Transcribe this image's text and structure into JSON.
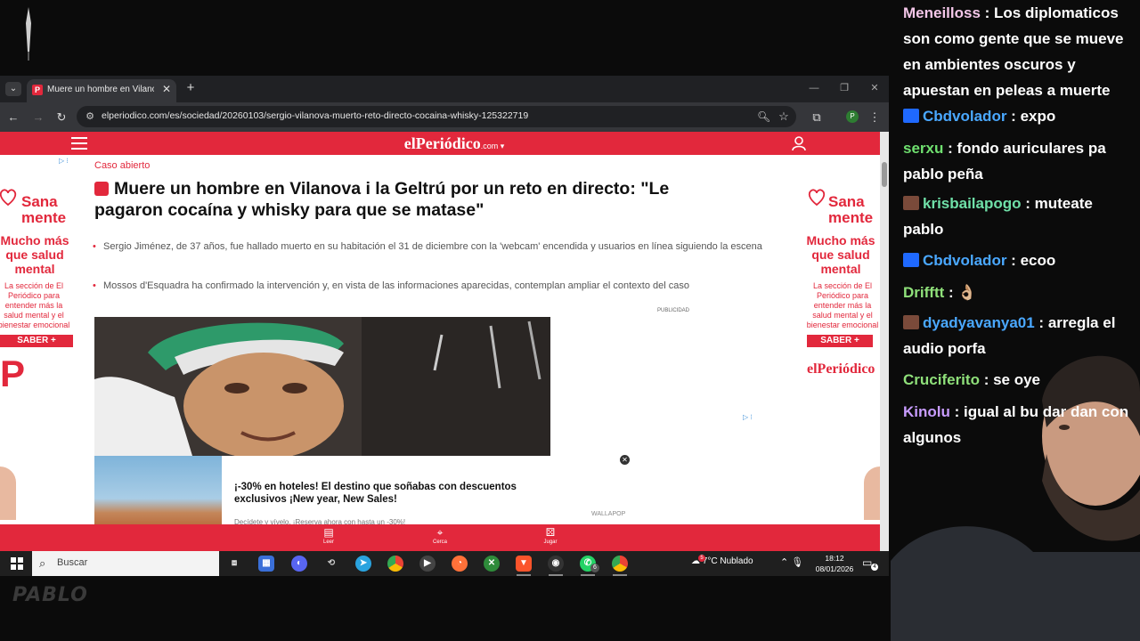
{
  "browser": {
    "tab_title": "Muere un hombre en Vilanova i la Geltrú",
    "url": "elperiodico.com/es/sociedad/20260103/sergio-vilanova-muerto-reto-directo-cocaina-whisky-125322719",
    "profile_initial": "P"
  },
  "site": {
    "logo_text": "elPeriódico",
    "logo_suffix": ".com"
  },
  "article": {
    "kicker": "Caso abierto",
    "headline": "Muere un hombre en Vilanova i la Geltrú por un reto en directo: \"Le pagaron cocaína y whisky para que se matase\"",
    "bullets": [
      "Sergio Jiménez, de 37 años, fue hallado muerto en su habitación el 31 de diciembre con la 'webcam' encendida y usuarios en línea siguiendo la escena",
      "Mossos d'Esquadra ha confirmado la intervención y, en vista de las informaciones aparecidas, contemplan ampliar el contexto del caso"
    ],
    "publicidad": "PUBLICIDAD"
  },
  "side_ad": {
    "brand_line1": "Sana",
    "brand_line2": "mente",
    "headline": "Mucho más que salud mental",
    "body": "La sección de El Periódico para entender más la salud mental y el bienestar emocional",
    "button": "SABER +",
    "brand_footer": "elPeriódico"
  },
  "hotel_ad": {
    "text": "¡-30% en hoteles! El destino que soñabas con descuentos exclusivos ¡New year, New Sales!",
    "sub": "Decídete y vívelo. ¡Reserva ahora con hasta un -30%!",
    "source": "WALLAPOP"
  },
  "bottom_nav": [
    {
      "label": "Leer",
      "icon": "document-icon"
    },
    {
      "label": "Cerca",
      "icon": "location-icon"
    },
    {
      "label": "Jugar",
      "icon": "dice-icon"
    }
  ],
  "taskbar": {
    "search_placeholder": "Buscar",
    "weather": "7°C  Nublado",
    "time": "18:12",
    "date": "08/01/2026",
    "weather_badge": "5",
    "whatsapp_badge": "6",
    "notif_badge": "4"
  },
  "chat": [
    {
      "user": "Meneilloss",
      "color": "#f3c6e8",
      "badge": "",
      "text": "Los diplomaticos son como gente que se mueve en ambientes oscuros y apuestan en peleas a muerte"
    },
    {
      "user": "Cbdvolador",
      "color": "#4aa8ff",
      "badge": "prime",
      "text": "expo"
    },
    {
      "user": "serxu",
      "color": "#6fe06f",
      "badge": "",
      "text": "fondo auriculares pa pablo peña"
    },
    {
      "user": "krisbailapogo",
      "color": "#6fe0a8",
      "badge": "sub",
      "text": "muteate pablo"
    },
    {
      "user": "Cbdvolador",
      "color": "#4aa8ff",
      "badge": "prime",
      "text": "ecoo"
    },
    {
      "user": "Drifftt",
      "color": "#8fe07a",
      "badge": "",
      "text": "👌🏼"
    },
    {
      "user": "dyadyavanya01",
      "color": "#4aa8ff",
      "badge": "sub",
      "text": "arregla el audio porfa"
    },
    {
      "user": "Cruciferito",
      "color": "#8fe07a",
      "badge": "",
      "text": "se oye"
    },
    {
      "user": "Kinolu",
      "color": "#c89cff",
      "badge": "",
      "text": "igual al bu dar dan con algunos"
    }
  ],
  "colors": {
    "brand_red": "#e2283c",
    "chrome_dark": "#202124"
  }
}
